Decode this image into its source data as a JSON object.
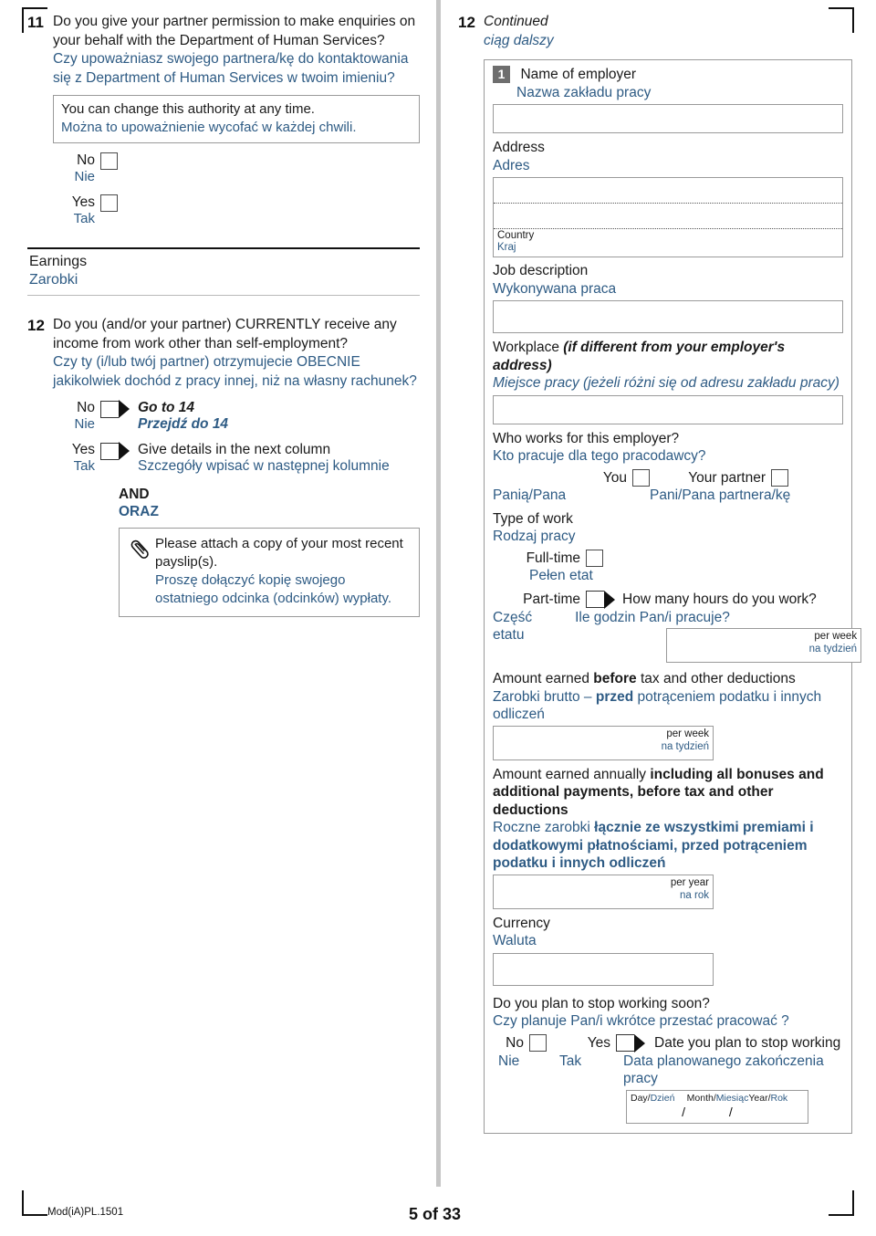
{
  "page": {
    "mod_code": "Mod(iA)PL.1501",
    "page_label": "5 of 33",
    "accent_blue": "#2e5b84",
    "badge_gray": "#6e6e6e"
  },
  "left_column": {
    "q11": {
      "number": "11",
      "en": "Do you give your partner permission to make enquiries on your behalf with the Department of Human Services?",
      "pl": "Czy upoważniasz swojego partnera/kę do kontaktowania się z Department of Human Services w twoim imieniu?",
      "note_en": "You can change this authority at any time.",
      "note_pl": "Można to upoważnienie wycofać w każdej chwili.",
      "options": [
        {
          "en": "No",
          "pl": "Nie"
        },
        {
          "en": "Yes",
          "pl": "Tak"
        }
      ]
    },
    "section": {
      "en": "Earnings",
      "pl": "Zarobki"
    },
    "q12": {
      "number": "12",
      "en": "Do you (and/or your partner) CURRENTLY receive any income from work other than self-employment?",
      "pl": "Czy ty (i/lub twój partner) otrzymujecie OBECNIE jakikolwiek dochód z pracy innej, niż na własny rachunek?",
      "options": [
        {
          "en": "No",
          "pl": "Nie",
          "after_en": "Go to 14",
          "after_pl": "Przejdź do 14",
          "bold": true
        },
        {
          "en": "Yes",
          "pl": "Tak",
          "after_en": "Give details in the next column",
          "after_pl": "Szczegóły wpisać w następnej kolumnie",
          "bold": false
        }
      ],
      "and_en": "AND",
      "and_pl": "ORAZ",
      "attach_icon": "paperclip-icon",
      "attach_en": "Please attach a copy of your most recent payslip(s).",
      "attach_pl": "Proszę dołączyć kopię swojego ostatniego odcinka (odcinków) wypłaty."
    }
  },
  "right_column": {
    "q12cont": {
      "number": "12",
      "en": "Continued",
      "pl": "ciąg dalszy"
    },
    "entry": {
      "badge": "1",
      "employer_en": "Name of employer",
      "employer_pl": "Nazwa zakładu pracy",
      "address_en": "Address",
      "address_pl": "Adres",
      "country_en": "Country",
      "country_pl": "Kraj",
      "job_en": "Job description",
      "job_pl": "Wykonywana praca",
      "workplace_en": "Workplace",
      "workplace_en_ital": "(if different from your employer's address)",
      "workplace_pl": "Miejsce pracy (jeżeli różni się od adresu zakładu pracy)",
      "who_en": "Who works for this employer?",
      "who_pl": "Kto pracuje dla tego pracodawcy?",
      "who_you_en": "You",
      "who_you_pl": "Panią/Pana",
      "who_partner_en": "Your partner",
      "who_partner_pl": "Pani/Pana partnera/kę",
      "type_en": "Type of work",
      "type_pl": "Rodzaj pracy",
      "fulltime_en": "Full-time",
      "fulltime_pl": "Pełen etat",
      "parttime_en": "Part-time",
      "parttime_pl": "Część etatu",
      "hours_en": "How many hours do you work?",
      "hours_pl": "Ile godzin Pan/i pracuje?",
      "per_week_en": "per week",
      "per_week_pl": "na tydzień",
      "before_en_a": "Amount earned ",
      "before_en_b": "before",
      "before_en_c": " tax and other deductions",
      "before_pl_a": "Zarobki brutto – ",
      "before_pl_b": "przed",
      "before_pl_c": " potrąceniem podatku i innych odliczeń",
      "annual_en_a": "Amount earned annually ",
      "annual_en_b": "including all bonuses and additional payments, before tax and other deductions",
      "annual_pl_a": "Roczne zarobki ",
      "annual_pl_b": "łącznie ze wszystkimi premiami i dodatkowymi płatnościami, przed potrąceniem podatku i innych odliczeń",
      "per_year_en": "per year",
      "per_year_pl": "na rok",
      "currency_en": "Currency",
      "currency_pl": "Waluta",
      "stop_en": "Do you plan to stop working soon?",
      "stop_pl": "Czy planuje Pan/i wkrótce przestać pracować ?",
      "stop_no_en": "No",
      "stop_no_pl": "Nie",
      "stop_yes_en": "Yes",
      "stop_yes_pl": "Tak",
      "stopdate_en": "Date you plan to stop working",
      "stopdate_pl": "Data planowanego zakończenia pracy",
      "date_day_en": "Day/",
      "date_day_pl": "Dzień",
      "date_month_en": "Month/",
      "date_month_pl": "Miesiąc",
      "date_year_en": "Year/",
      "date_year_pl": "Rok",
      "date_value": "/        /"
    }
  }
}
